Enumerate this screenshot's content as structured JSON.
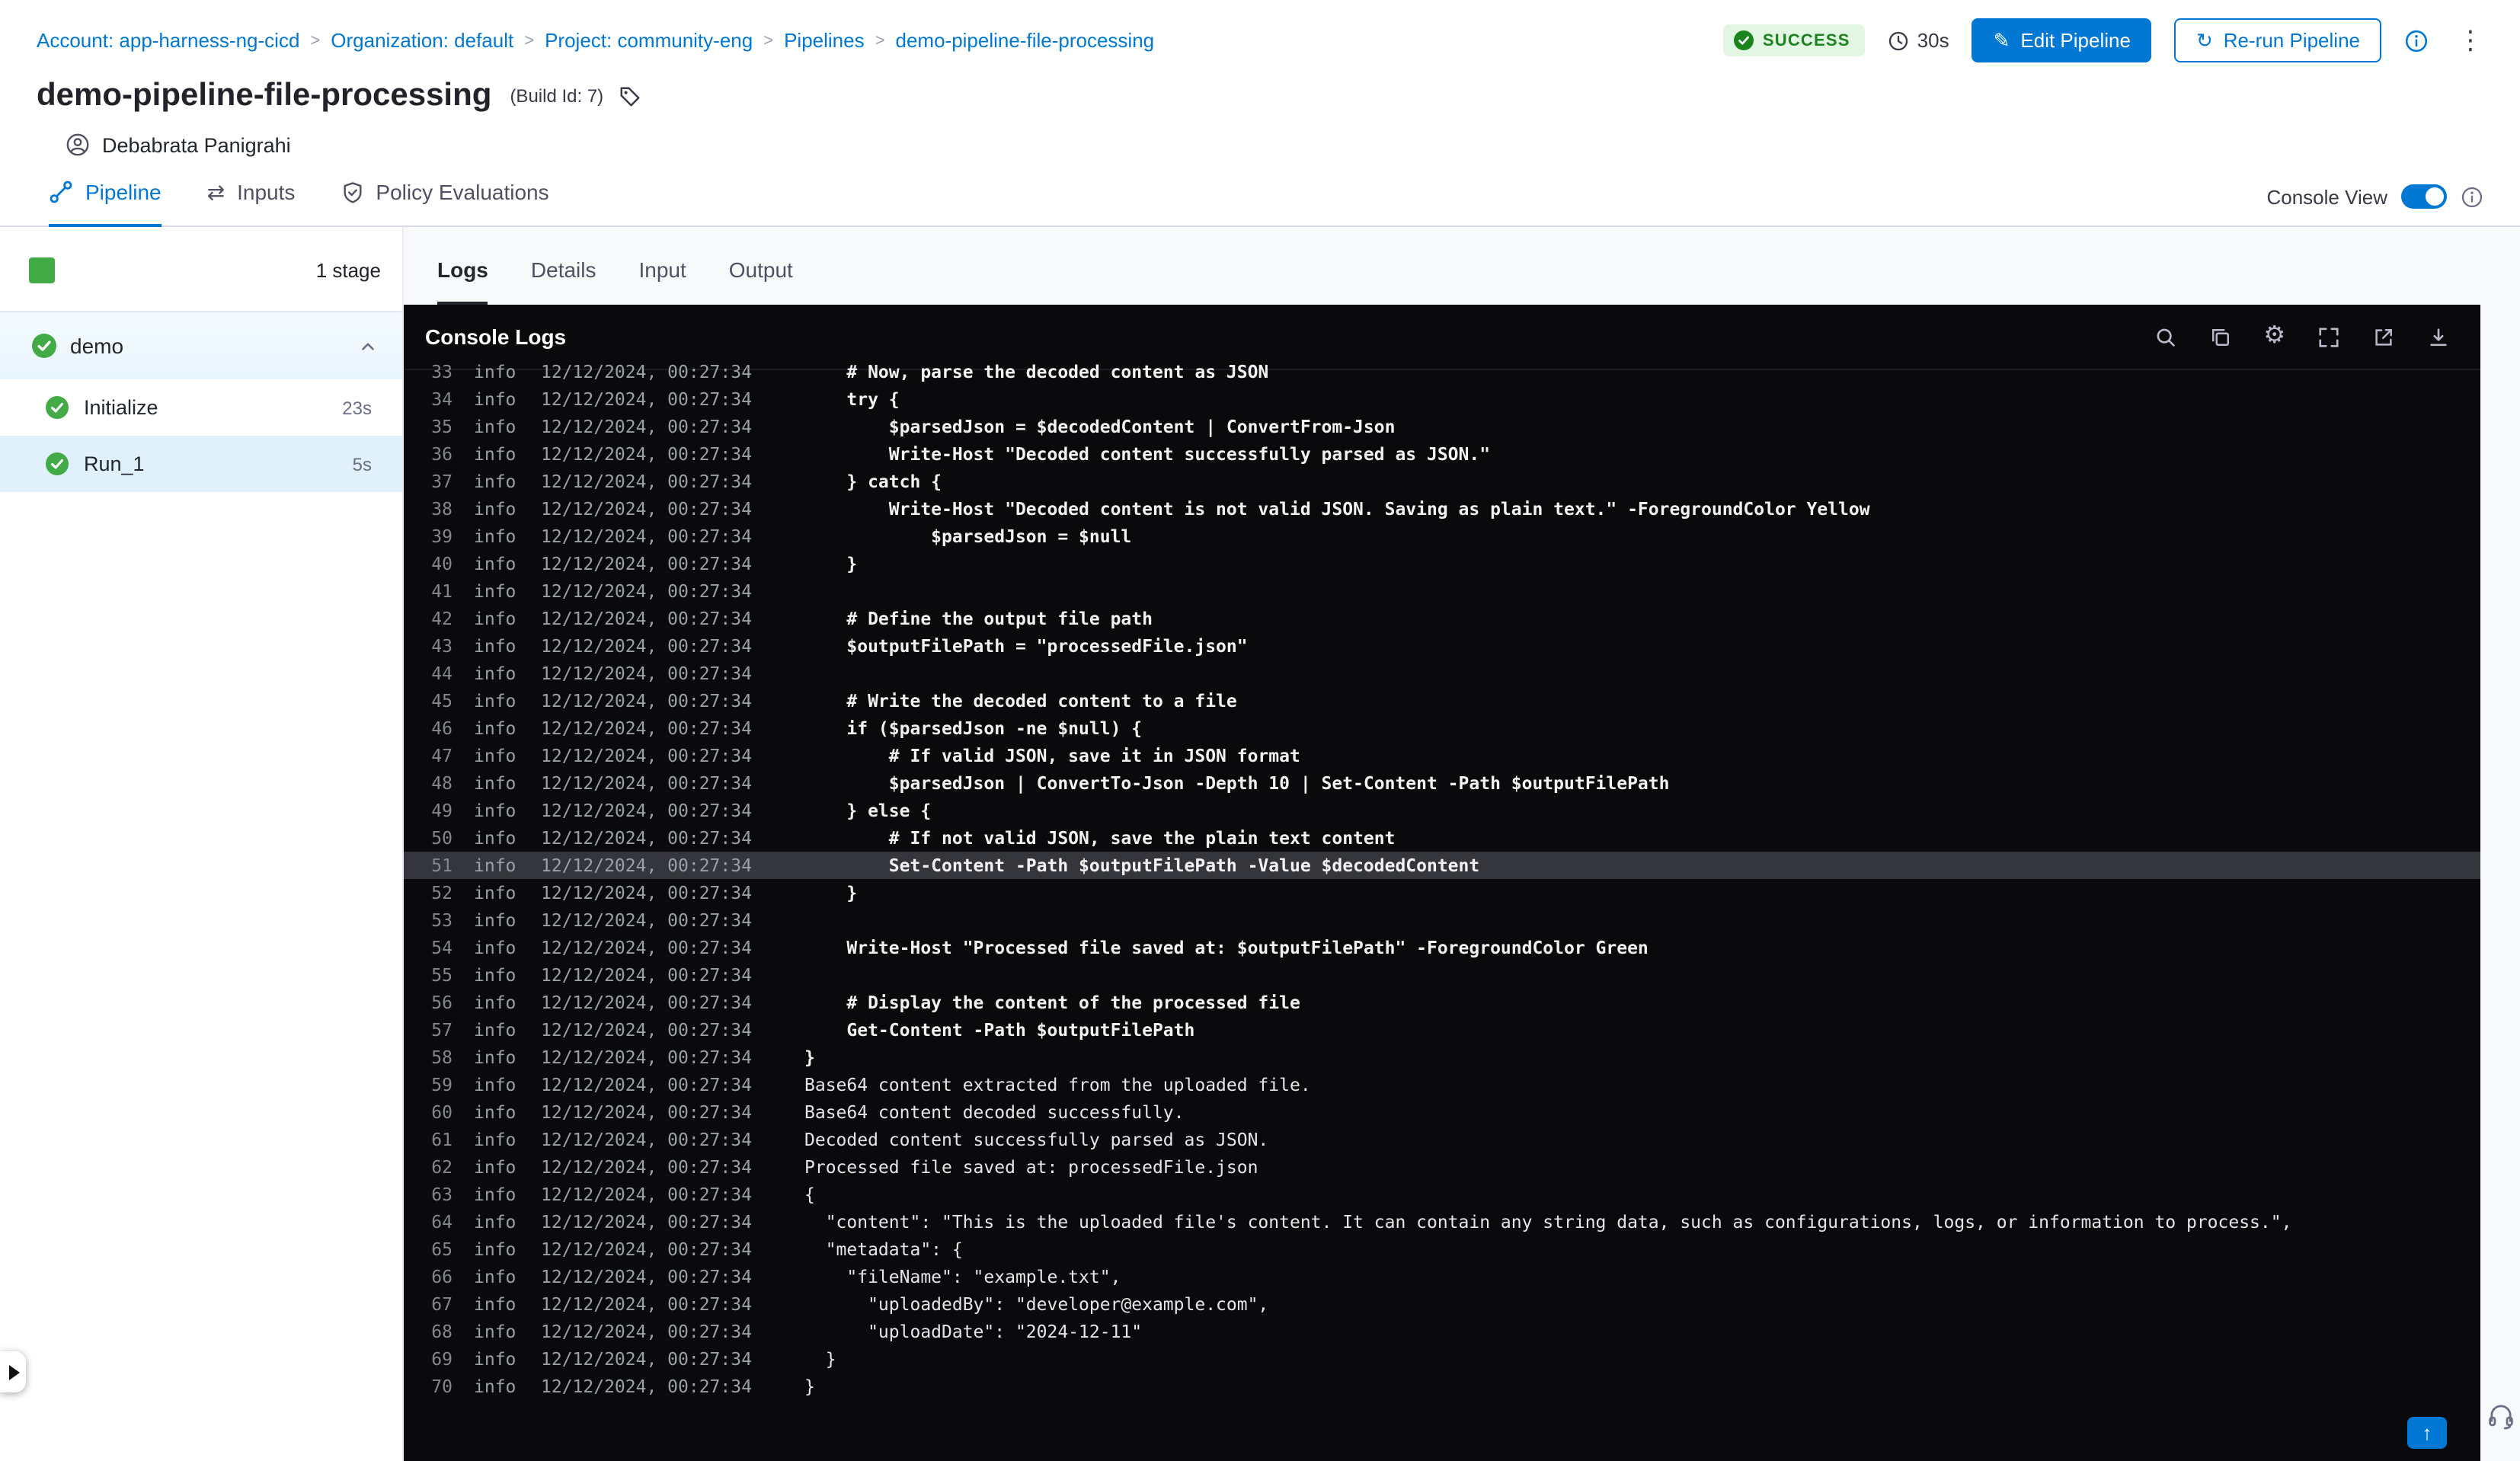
{
  "breadcrumb": {
    "separator": ">",
    "items": [
      {
        "label": "Account: app-harness-ng-cicd"
      },
      {
        "label": "Organization: default"
      },
      {
        "label": "Project: community-eng"
      },
      {
        "label": "Pipelines"
      },
      {
        "label": "demo-pipeline-file-processing"
      }
    ]
  },
  "header": {
    "status": "SUCCESS",
    "duration": "30s",
    "edit_pipeline": "Edit Pipeline",
    "rerun_pipeline": "Re-run Pipeline",
    "title": "demo-pipeline-file-processing",
    "build_id": "(Build Id: 7)",
    "user_name": "Debabrata Panigrahi"
  },
  "nav_tabs": {
    "pipeline": "Pipeline",
    "inputs": "Inputs",
    "policy": "Policy Evaluations",
    "console_view": "Console View"
  },
  "sidebar": {
    "stage_count": "1 stage",
    "stage_name": "demo",
    "steps": [
      {
        "name": "Initialize",
        "duration": "23s"
      },
      {
        "name": "Run_1",
        "duration": "5s",
        "selected": true
      }
    ]
  },
  "log_tabs": {
    "logs": "Logs",
    "details": "Details",
    "input": "Input",
    "output": "Output"
  },
  "console": {
    "title": "Console Logs",
    "lines": [
      {
        "n": "33",
        "level": "info",
        "ts": "12/12/2024, 00:27:34",
        "text": "    # Now, parse the decoded content as JSON",
        "bold": true
      },
      {
        "n": "34",
        "level": "info",
        "ts": "12/12/2024, 00:27:34",
        "text": "    try {",
        "bold": true
      },
      {
        "n": "35",
        "level": "info",
        "ts": "12/12/2024, 00:27:34",
        "text": "        $parsedJson = $decodedContent | ConvertFrom-Json",
        "bold": true
      },
      {
        "n": "36",
        "level": "info",
        "ts": "12/12/2024, 00:27:34",
        "text": "        Write-Host \"Decoded content successfully parsed as JSON.\"",
        "bold": true
      },
      {
        "n": "37",
        "level": "info",
        "ts": "12/12/2024, 00:27:34",
        "text": "    } catch {",
        "bold": true
      },
      {
        "n": "38",
        "level": "info",
        "ts": "12/12/2024, 00:27:34",
        "text": "        Write-Host \"Decoded content is not valid JSON. Saving as plain text.\" -ForegroundColor Yellow",
        "bold": true
      },
      {
        "n": "39",
        "level": "info",
        "ts": "12/12/2024, 00:27:34",
        "text": "            $parsedJson = $null",
        "bold": true
      },
      {
        "n": "40",
        "level": "info",
        "ts": "12/12/2024, 00:27:34",
        "text": "    }",
        "bold": true
      },
      {
        "n": "41",
        "level": "info",
        "ts": "12/12/2024, 00:27:34",
        "text": "",
        "bold": true
      },
      {
        "n": "42",
        "level": "info",
        "ts": "12/12/2024, 00:27:34",
        "text": "    # Define the output file path",
        "bold": true
      },
      {
        "n": "43",
        "level": "info",
        "ts": "12/12/2024, 00:27:34",
        "text": "    $outputFilePath = \"processedFile.json\"",
        "bold": true
      },
      {
        "n": "44",
        "level": "info",
        "ts": "12/12/2024, 00:27:34",
        "text": "",
        "bold": true
      },
      {
        "n": "45",
        "level": "info",
        "ts": "12/12/2024, 00:27:34",
        "text": "    # Write the decoded content to a file",
        "bold": true
      },
      {
        "n": "46",
        "level": "info",
        "ts": "12/12/2024, 00:27:34",
        "text": "    if ($parsedJson -ne $null) {",
        "bold": true
      },
      {
        "n": "47",
        "level": "info",
        "ts": "12/12/2024, 00:27:34",
        "text": "        # If valid JSON, save it in JSON format",
        "bold": true
      },
      {
        "n": "48",
        "level": "info",
        "ts": "12/12/2024, 00:27:34",
        "text": "        $parsedJson | ConvertTo-Json -Depth 10 | Set-Content -Path $outputFilePath",
        "bold": true
      },
      {
        "n": "49",
        "level": "info",
        "ts": "12/12/2024, 00:27:34",
        "text": "    } else {",
        "bold": true
      },
      {
        "n": "50",
        "level": "info",
        "ts": "12/12/2024, 00:27:34",
        "text": "        # If not valid JSON, save the plain text content",
        "bold": true
      },
      {
        "n": "51",
        "level": "info",
        "ts": "12/12/2024, 00:27:34",
        "text": "        Set-Content -Path $outputFilePath -Value $decodedContent",
        "bold": true,
        "highlight": true
      },
      {
        "n": "52",
        "level": "info",
        "ts": "12/12/2024, 00:27:34",
        "text": "    }",
        "bold": true
      },
      {
        "n": "53",
        "level": "info",
        "ts": "12/12/2024, 00:27:34",
        "text": "",
        "bold": true
      },
      {
        "n": "54",
        "level": "info",
        "ts": "12/12/2024, 00:27:34",
        "text": "    Write-Host \"Processed file saved at: $outputFilePath\" -ForegroundColor Green",
        "bold": true
      },
      {
        "n": "55",
        "level": "info",
        "ts": "12/12/2024, 00:27:34",
        "text": "",
        "bold": true
      },
      {
        "n": "56",
        "level": "info",
        "ts": "12/12/2024, 00:27:34",
        "text": "    # Display the content of the processed file",
        "bold": true
      },
      {
        "n": "57",
        "level": "info",
        "ts": "12/12/2024, 00:27:34",
        "text": "    Get-Content -Path $outputFilePath",
        "bold": true
      },
      {
        "n": "58",
        "level": "info",
        "ts": "12/12/2024, 00:27:34",
        "text": "}",
        "bold": true
      },
      {
        "n": "59",
        "level": "info",
        "ts": "12/12/2024, 00:27:34",
        "text": "Base64 content extracted from the uploaded file."
      },
      {
        "n": "60",
        "level": "info",
        "ts": "12/12/2024, 00:27:34",
        "text": "Base64 content decoded successfully."
      },
      {
        "n": "61",
        "level": "info",
        "ts": "12/12/2024, 00:27:34",
        "text": "Decoded content successfully parsed as JSON."
      },
      {
        "n": "62",
        "level": "info",
        "ts": "12/12/2024, 00:27:34",
        "text": "Processed file saved at: processedFile.json"
      },
      {
        "n": "63",
        "level": "info",
        "ts": "12/12/2024, 00:27:34",
        "text": "{"
      },
      {
        "n": "64",
        "level": "info",
        "ts": "12/12/2024, 00:27:34",
        "text": "  \"content\": \"This is the uploaded file's content. It can contain any string data, such as configurations, logs, or information to process.\","
      },
      {
        "n": "65",
        "level": "info",
        "ts": "12/12/2024, 00:27:34",
        "text": "  \"metadata\": {"
      },
      {
        "n": "66",
        "level": "info",
        "ts": "12/12/2024, 00:27:34",
        "text": "    \"fileName\": \"example.txt\","
      },
      {
        "n": "67",
        "level": "info",
        "ts": "12/12/2024, 00:27:34",
        "text": "      \"uploadedBy\": \"developer@example.com\","
      },
      {
        "n": "68",
        "level": "info",
        "ts": "12/12/2024, 00:27:34",
        "text": "      \"uploadDate\": \"2024-12-11\""
      },
      {
        "n": "69",
        "level": "info",
        "ts": "12/12/2024, 00:27:34",
        "text": "  }"
      },
      {
        "n": "70",
        "level": "info",
        "ts": "12/12/2024, 00:27:34",
        "text": "}"
      }
    ]
  },
  "icons": {
    "edit": "✎",
    "rerun": "↻",
    "kebab": "⋮",
    "gear": "⚙",
    "inputs_glyph": "⇄",
    "scroll_top": "↑"
  },
  "colors": {
    "accent": "#0278d5",
    "success_badge_bg": "#e2f6e3",
    "success_badge_text": "#1b841d",
    "step_check_green": "#42ab45",
    "console_bg": "#0a0a0d",
    "highlight_row": "#35363b",
    "selected_step_bg": "#e0f1fb"
  }
}
